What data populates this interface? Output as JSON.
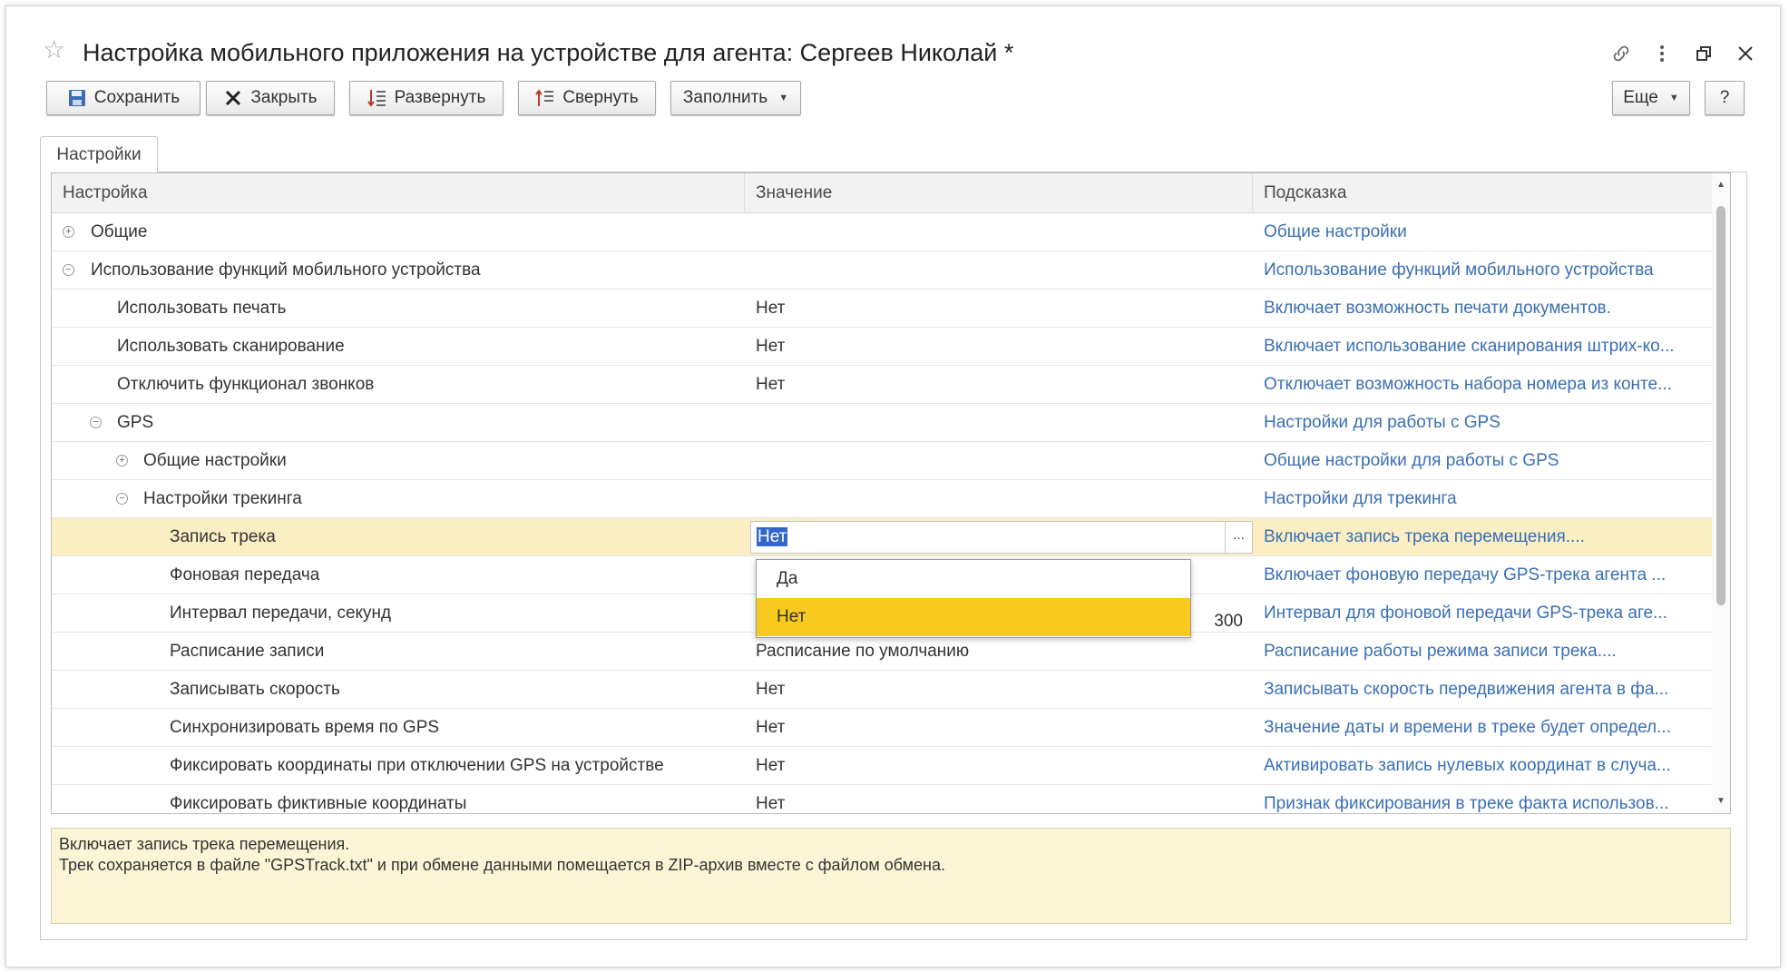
{
  "window": {
    "title": "Настройка мобильного приложения на устройстве для агента: Сергеев Николай *"
  },
  "toolbar": {
    "save_label": "Сохранить",
    "close_label": "Закрыть",
    "expand_label": "Развернуть",
    "collapse_label": "Свернуть",
    "fill_label": "Заполнить",
    "more_label": "Еще",
    "help_label": "?"
  },
  "tabs": [
    {
      "label": "Настройки"
    }
  ],
  "table": {
    "headers": {
      "setting": "Настройка",
      "value": "Значение",
      "hint": "Подсказка"
    },
    "rows": [
      {
        "name": "Общие",
        "value": "",
        "hint": "Общие настройки"
      },
      {
        "name": "Использование функций мобильного устройства",
        "value": "",
        "hint": "Использование функций мобильного устройства"
      },
      {
        "name": "Использовать печать",
        "value": "Нет",
        "hint": "Включает возможность печати документов."
      },
      {
        "name": "Использовать сканирование",
        "value": "Нет",
        "hint": "Включает использование сканирования штрих-ко..."
      },
      {
        "name": "Отключить функционал звонков",
        "value": "Нет",
        "hint": "Отключает возможность набора номера из конте..."
      },
      {
        "name": "GPS",
        "value": "",
        "hint": "Настройки для работы с GPS"
      },
      {
        "name": "Общие настройки",
        "value": "",
        "hint": "Общие настройки для работы с GPS"
      },
      {
        "name": "Настройки трекинга",
        "value": "",
        "hint": "Настройки для трекинга"
      },
      {
        "name": "Запись трека",
        "value": "Нет",
        "hint": "Включает запись трека перемещения...."
      },
      {
        "name": "Фоновая передача",
        "value": "",
        "hint": "Включает фоновую передачу GPS-трека агента ..."
      },
      {
        "name": "Интервал передачи, секунд",
        "value": "300",
        "hint": "Интервал для фоновой передачи GPS-трека аге..."
      },
      {
        "name": "Расписание записи",
        "value": "Расписание по умолчанию",
        "hint": "Расписание работы режима записи трека...."
      },
      {
        "name": "Записывать скорость",
        "value": "Нет",
        "hint": "Записывать скорость передвижения агента в фа..."
      },
      {
        "name": "Синхронизировать время по GPS",
        "value": "Нет",
        "hint": "Значение даты и времени в треке будет определ..."
      },
      {
        "name": "Фиксировать координаты при отключении GPS на устройстве",
        "value": "Нет",
        "hint": "Активировать запись нулевых координат в случа..."
      },
      {
        "name": "Фиксировать фиктивные координаты",
        "value": "Нет",
        "hint": "Признак фиксирования в треке факта использов..."
      }
    ]
  },
  "edit": {
    "ellipsis": "..."
  },
  "dropdown": {
    "options": [
      "Да",
      "Нет"
    ],
    "selected": "Нет"
  },
  "hint_panel": {
    "line1": "Включает запись трека перемещения.",
    "line2": "Трек сохраняется в файле \"GPSTrack.txt\" и при обмене данными помещается в ZIP-архив вместе с файлом обмена."
  },
  "colors": {
    "link": "#3a6fb5",
    "selected_row": "#fbeec3",
    "dropdown_active": "#f8c91f",
    "hint_bg": "#fbf5d6"
  },
  "icons": [
    "star-icon",
    "link-icon",
    "more-vert-icon",
    "restore-icon",
    "close-icon",
    "save-icon",
    "close-x-icon",
    "expand-icon",
    "collapse-icon"
  ]
}
